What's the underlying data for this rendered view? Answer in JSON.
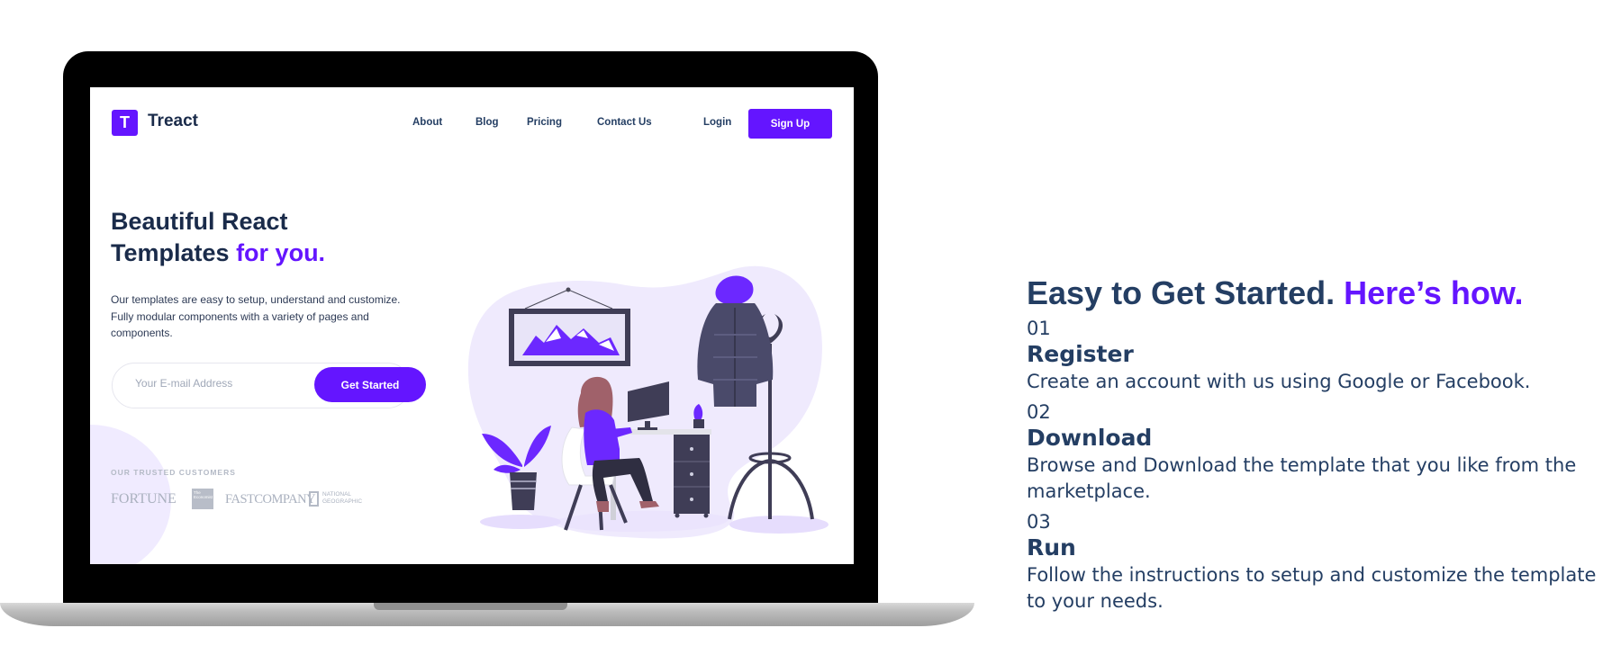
{
  "mockup": {
    "logo_letter": "T",
    "brand": "Treact",
    "nav": [
      "About",
      "Blog",
      "Pricing",
      "Contact Us"
    ],
    "login": "Login",
    "signup": "Sign Up",
    "heading_main": "Beautiful React Templates",
    "heading_accent": "for you.",
    "description": "Our templates are easy to setup, understand and customize. Fully modular components with a variety of pages and components.",
    "email_placeholder": "Your E-mail Address",
    "cta": "Get Started",
    "trusted_label": "OUR TRUSTED CUSTOMERS",
    "customers": {
      "fortune": "FORTUNE",
      "economist": "The Economist",
      "fastcompany": "FASTCOMPANY",
      "natgeo": "NATIONAL GEOGRAPHIC"
    }
  },
  "section": {
    "title_main": "Easy to Get Started.",
    "title_accent": "Here’s how.",
    "steps": [
      {
        "number": "01",
        "heading": "Register",
        "text": "Create an account with us using Google or Facebook."
      },
      {
        "number": "02",
        "heading": "Download",
        "text": "Browse and Download the template that you like from the marketplace."
      },
      {
        "number": "03",
        "heading": "Run",
        "text": "Follow the instructions to setup and customize the template to your needs."
      }
    ]
  },
  "colors": {
    "accent": "#6415FF",
    "heading": "#243E63",
    "blob": "#f0ebff"
  }
}
